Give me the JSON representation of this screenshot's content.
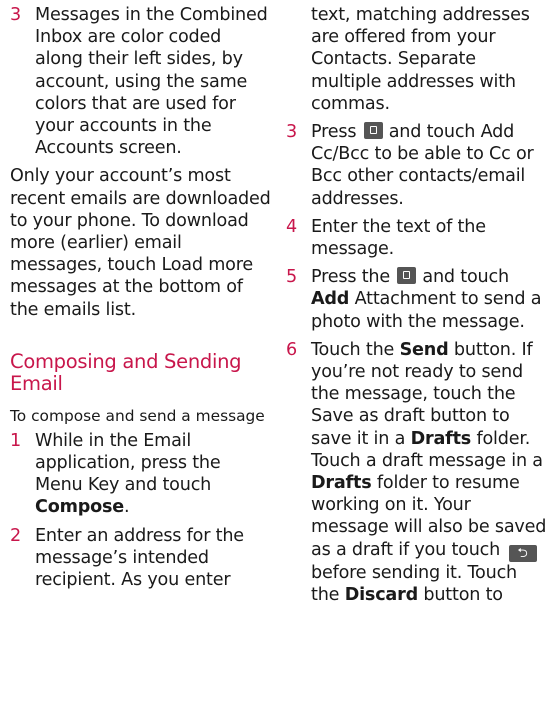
{
  "left": {
    "item3_num": "3",
    "item3_text": "Messages in the Combined Inbox are color coded along their left sides, by account, using the same colors that are used for your accounts in the Accounts screen.",
    "para": "Only your account’s most recent emails are downloaded to your phone. To download more (earlier) email messages, touch Load more messages at the bottom of the emails list.",
    "heading": "Composing and Sending Email",
    "intro": "To compose and send a message",
    "item1_num": "1",
    "item1_text": "While in the Email application, press the Menu Key and touch",
    "item1_bold": "Compose",
    "item1_end": ".",
    "item2_num": "2",
    "item2_text": "Enter an address for the message’s intended recipient. As you enter"
  },
  "right": {
    "cont_text": "text, matching addresses are offered from your Contacts. Separate multiple addresses with commas.",
    "item3_num": "3",
    "item3_a": "Press",
    "item3_b": "and touch Add Cc/Bcc to be able to Cc or Bcc other contacts/email addresses.",
    "item4_num": "4",
    "item4_text": "Enter the text of the message.",
    "item5_num": "5",
    "item5_a": "Press the",
    "item5_b": "and touch",
    "item5_bold": "Add",
    "item5_c": "Attachment to send a photo with the message.",
    "item6_num": "6",
    "item6_a": "Touch the",
    "item6_send": "Send",
    "item6_b": "button. If you’re not ready to send the message, touch the Save as draft button to save it in a",
    "item6_drafts1": "Drafts",
    "item6_c": "folder. Touch a draft message in a",
    "item6_drafts2": "Drafts",
    "item6_d": "folder to resume working on it. Your message will also be saved as a draft if you touch",
    "item6_e": "before sending it. Touch the",
    "item6_discard": "Discard",
    "item6_f": "button to"
  },
  "icons": {
    "menu_key": "menu-key-icon",
    "back_key": "back-key-icon"
  }
}
